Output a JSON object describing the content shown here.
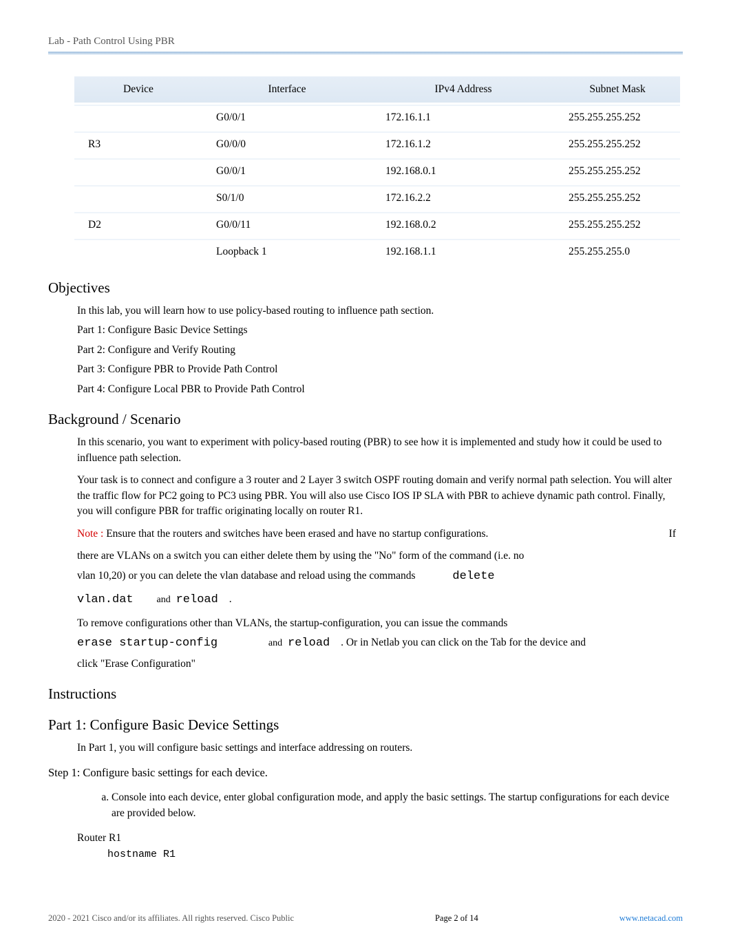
{
  "header": {
    "title": "Lab - Path Control Using PBR"
  },
  "table": {
    "headers": {
      "device": "Device",
      "interface": "Interface",
      "ipv4": "IPv4 Address",
      "mask": "Subnet Mask"
    },
    "rows": [
      {
        "device": "",
        "interface": "G0/0/1",
        "ipv4": "172.16.1.1",
        "mask": "255.255.255.252"
      },
      {
        "device": "R3",
        "interface": "G0/0/0",
        "ipv4": "172.16.1.2",
        "mask": "255.255.255.252"
      },
      {
        "device": "",
        "interface": "G0/0/1",
        "ipv4": "192.168.0.1",
        "mask": "255.255.255.252"
      },
      {
        "device": "",
        "interface": "S0/1/0",
        "ipv4": "172.16.2.2",
        "mask": "255.255.255.252"
      },
      {
        "device": "D2",
        "interface": "G0/0/11",
        "ipv4": "192.168.0.2",
        "mask": "255.255.255.252"
      },
      {
        "device": "",
        "interface": "Loopback 1",
        "ipv4": "192.168.1.1",
        "mask": "255.255.255.0"
      }
    ]
  },
  "objectives": {
    "heading": "Objectives",
    "intro": "In this lab, you will learn how to use policy-based routing to influence path section.",
    "parts": [
      "Part 1: Configure Basic Device Settings",
      "Part 2: Configure and Verify Routing",
      "Part 3: Configure PBR to Provide Path Control",
      "Part 4: Configure Local PBR to Provide Path Control"
    ]
  },
  "background": {
    "heading": "Background / Scenario",
    "p1": "In this scenario, you want to experiment with policy-based routing (PBR) to see how it is implemented and study how it could be used to influence path selection.",
    "p2": "Your task is to connect and configure a 3 router and 2 Layer 3 switch OSPF routing domain and verify normal path selection. You will alter the traffic flow for PC2 going to PC3 using PBR. You will also use Cisco IOS IP SLA with PBR to achieve dynamic path control. Finally, you will configure PBR for traffic originating locally on router R1.",
    "note_label": "Note :",
    "note_body_1": " Ensure that the routers and switches have been erased and have no startup configurations.",
    "note_if": "If",
    "note_body_2": "there are VLANs on a switch you can either delete them by using the \"No\" form of the command (i.e. no",
    "note_body_3": "vlan 10,20) or you can delete the vlan database and reload using the commands",
    "cmd_delete": "delete",
    "cmd_vlan": "vlan.dat",
    "and1": "and",
    "cmd_reload1": "reload",
    "dot1": ".",
    "p3": "To remove configurations other than VLANs, the startup-configuration, you can issue the commands",
    "cmd_erase": "erase startup-config",
    "and2": "and",
    "cmd_reload2": "reload",
    "p3_tail": ".  Or in Netlab you can click on the Tab for the device and",
    "p4": "click \"Erase Configuration\""
  },
  "instructions": {
    "heading": "Instructions"
  },
  "part1": {
    "heading": "Part 1: Configure Basic Device Settings",
    "intro": "In Part 1, you will configure basic settings and interface addressing on routers.",
    "step1_title": "Step 1: Configure basic settings for each device.",
    "step1_a": "Console into each device, enter global configuration mode, and apply the basic settings. The startup configurations for each device are provided below.",
    "router_label": "Router R1",
    "code_line": "hostname R1"
  },
  "footer": {
    "copyright": " 2020 - 2021 Cisco and/or its affiliates. All rights reserved. Cisco Public",
    "page": "Page  2 of 14",
    "link": "www.netacad.com"
  }
}
